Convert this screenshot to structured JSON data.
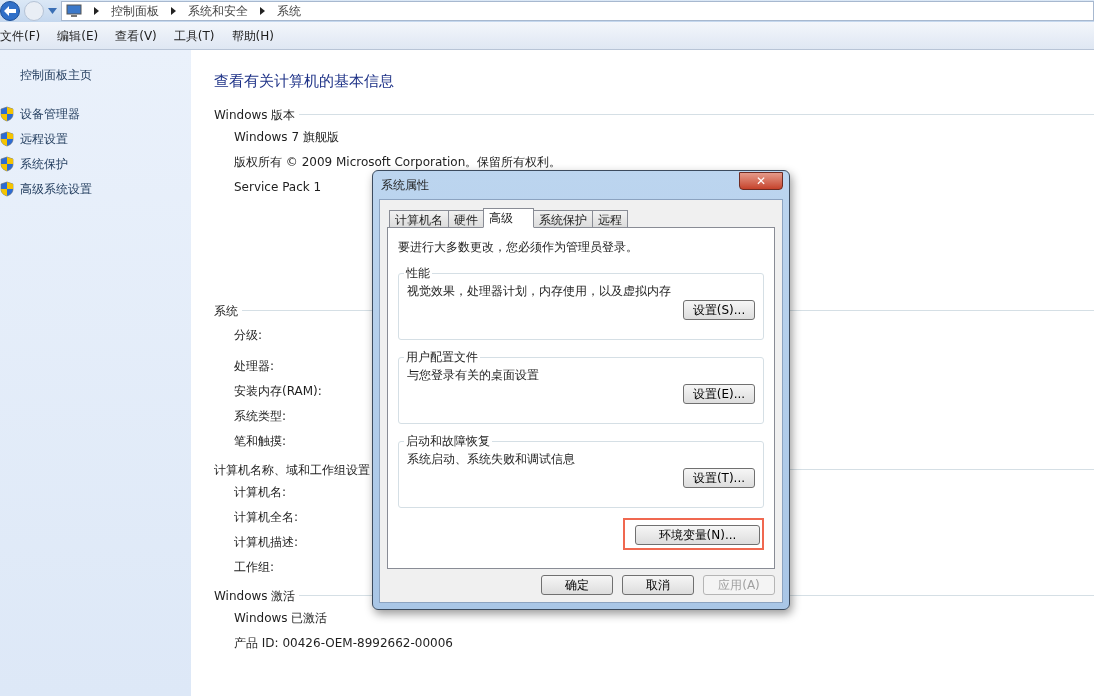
{
  "breadcrumb": [
    "控制面板",
    "系统和安全",
    "系统"
  ],
  "menu": [
    "文件(F)",
    "编辑(E)",
    "查看(V)",
    "工具(T)",
    "帮助(H)"
  ],
  "sidebar": {
    "home": "控制面板主页",
    "items": [
      "设备管理器",
      "远程设置",
      "系统保护",
      "高级系统设置"
    ]
  },
  "title": "查看有关计算机的基本信息",
  "sections": [
    {
      "heading": "Windows 版本",
      "rows": [
        "Windows 7 旗舰版",
        "版权所有 © 2009 Microsoft Corporation。保留所有权利。",
        "Service Pack 1"
      ]
    },
    {
      "heading": "系统",
      "rows": [
        "分级:",
        "处理器:",
        "安装内存(RAM):",
        "系统类型:",
        "笔和触摸:"
      ]
    },
    {
      "heading": "计算机名称、域和工作组设置",
      "rows": [
        "计算机名:",
        "计算机全名:",
        "计算机描述:",
        "工作组:"
      ]
    },
    {
      "heading": "Windows 激活",
      "rows": [
        "Windows 已激活",
        "产品 ID: 00426-OEM-8992662-00006"
      ]
    }
  ],
  "dialog": {
    "title": "系统属性",
    "close": "✕",
    "tabs": [
      {
        "label": "计算机名",
        "selected": false
      },
      {
        "label": "硬件",
        "selected": false
      },
      {
        "label": "高级",
        "selected": true
      },
      {
        "label": "系统保护",
        "selected": false
      },
      {
        "label": "远程",
        "selected": false
      }
    ],
    "notice": "要进行大多数更改，您必须作为管理员登录。",
    "groups": [
      {
        "legend": "性能",
        "text": "视觉效果，处理器计划，内存使用，以及虚拟内存",
        "button": "设置(S)..."
      },
      {
        "legend": "用户配置文件",
        "text": "与您登录有关的桌面设置",
        "button": "设置(E)..."
      },
      {
        "legend": "启动和故障恢复",
        "text": "系统启动、系统失败和调试信息",
        "button": "设置(T)..."
      }
    ],
    "env_button": {
      "label": "环境变量(N)...",
      "highlighted": true
    },
    "buttons": [
      {
        "label": "确定",
        "disabled": false
      },
      {
        "label": "取消",
        "disabled": false
      },
      {
        "label": "应用(A)",
        "disabled": true
      }
    ]
  }
}
